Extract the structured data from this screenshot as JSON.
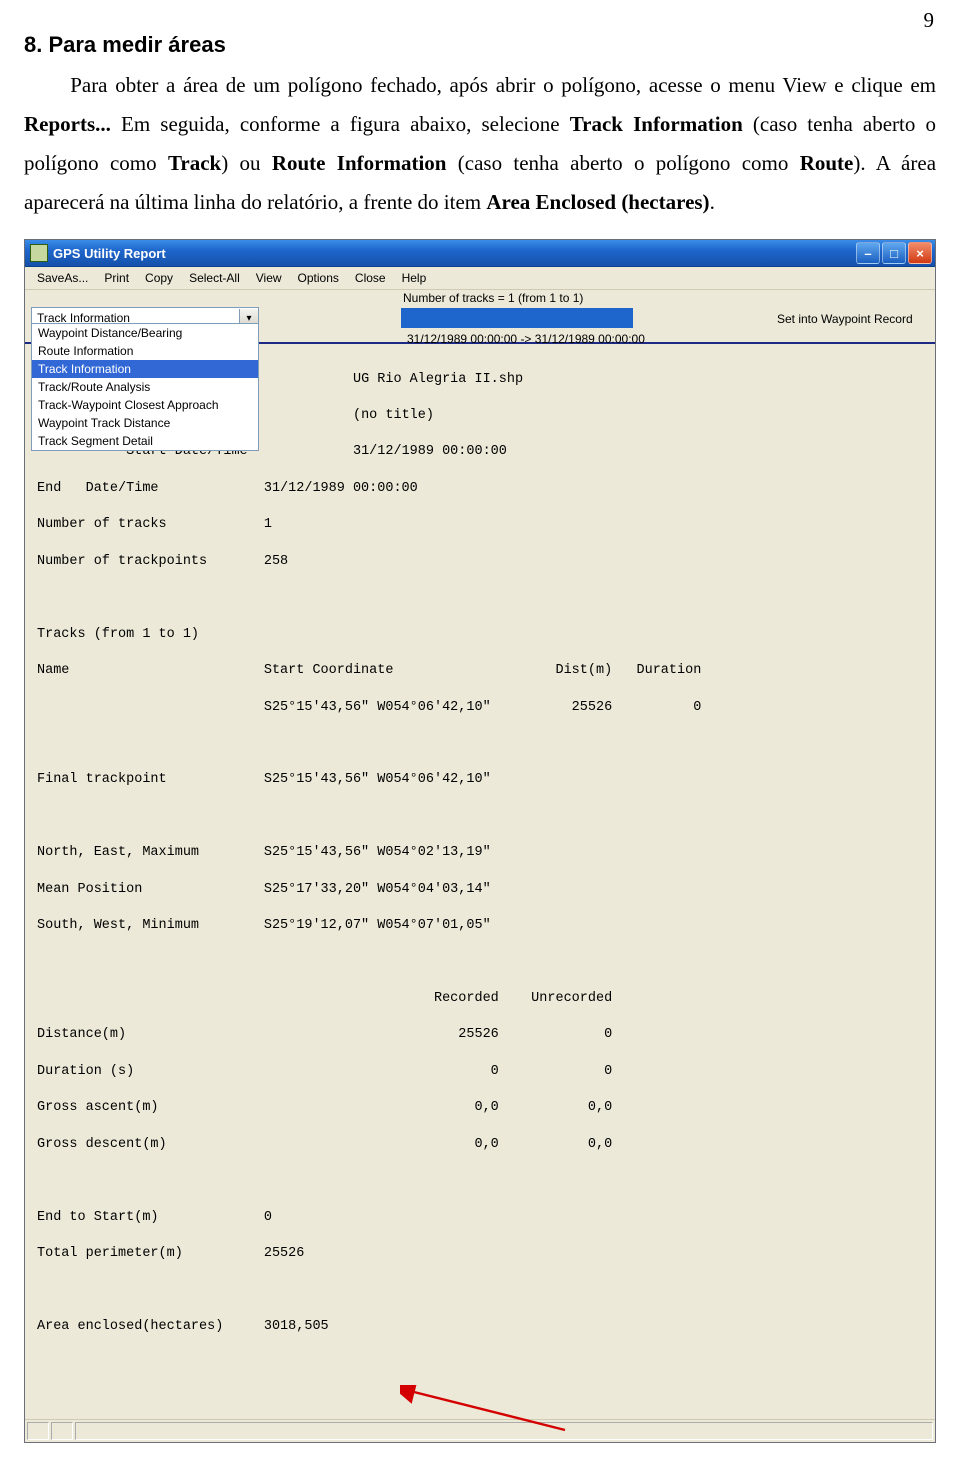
{
  "page_number": "9",
  "doc": {
    "heading": "8. Para medir áreas",
    "p1a": "Para obter a área de um polígono fechado, após abrir o polígono, acesse o menu View e clique em ",
    "reports": "Reports...",
    "p1b": " Em seguida, conforme a figura abaixo, selecione ",
    "trackinfo": "Track Information",
    "p1c": " (caso tenha aberto o polígono como ",
    "trackword": "Track",
    "p1d": ") ou ",
    "routeinfo": "Route Information",
    "p1e": " (caso tenha aberto o polígono como ",
    "routeword": "Route",
    "p1f": "). A área aparecerá na última linha do relatório, a frente do item ",
    "areaenc": "Area Enclosed (hectares)",
    "period": "."
  },
  "window": {
    "title": "GPS Utility Report",
    "menu": [
      "SaveAs...",
      "Print",
      "Copy",
      "Select-All",
      "View",
      "Options",
      "Close",
      "Help"
    ],
    "combo_value": "Track Information",
    "dropdown_options": [
      "Waypoint Distance/Bearing",
      "Route Information",
      "Track Information",
      "Track/Route Analysis",
      "Track-Waypoint Closest Approach",
      "Waypoint Track Distance",
      "Track Segment Detail"
    ],
    "dropdown_selected_index": 2,
    "tracks_summary": "Number of tracks = 1   (from 1 to 1)",
    "date_range": "31/12/1989 00:00:00 -> 31/12/1989 00:00:00",
    "right_label": "Set into Waypoint Record",
    "report": {
      "l0": "File                        UG Rio Alegria II.shp",
      "l1": "Title                       (no title)",
      "l2": "Start Date/Time             31/12/1989 00:00:00",
      "l3": "End   Date/Time             31/12/1989 00:00:00",
      "l4": "Number of tracks            1",
      "l5": "Number of trackpoints       258",
      "l6": "Tracks (from 1 to 1)",
      "l7": "Name                        Start Coordinate                    Dist(m)   Duration",
      "l8": "                            S25°15'43,56\" W054°06'42,10\"          25526          0",
      "l9": "Final trackpoint            S25°15'43,56\" W054°06'42,10\"",
      "l10": "North, East, Maximum        S25°15'43,56\" W054°02'13,19\"",
      "l11": "Mean Position               S25°17'33,20\" W054°04'03,14\"",
      "l12": "South, West, Minimum        S25°19'12,07\" W054°07'01,05\"",
      "l13": "                                                 Recorded    Unrecorded",
      "l14": "Distance(m)                                         25526             0",
      "l15": "Duration (s)                                            0             0",
      "l16": "Gross ascent(m)                                       0,0           0,0",
      "l17": "Gross descent(m)                                      0,0           0,0",
      "l18": "End to Start(m)             0",
      "l19": "Total perimeter(m)          25526",
      "l20": "Area enclosed(hectares)     3018,505"
    }
  }
}
